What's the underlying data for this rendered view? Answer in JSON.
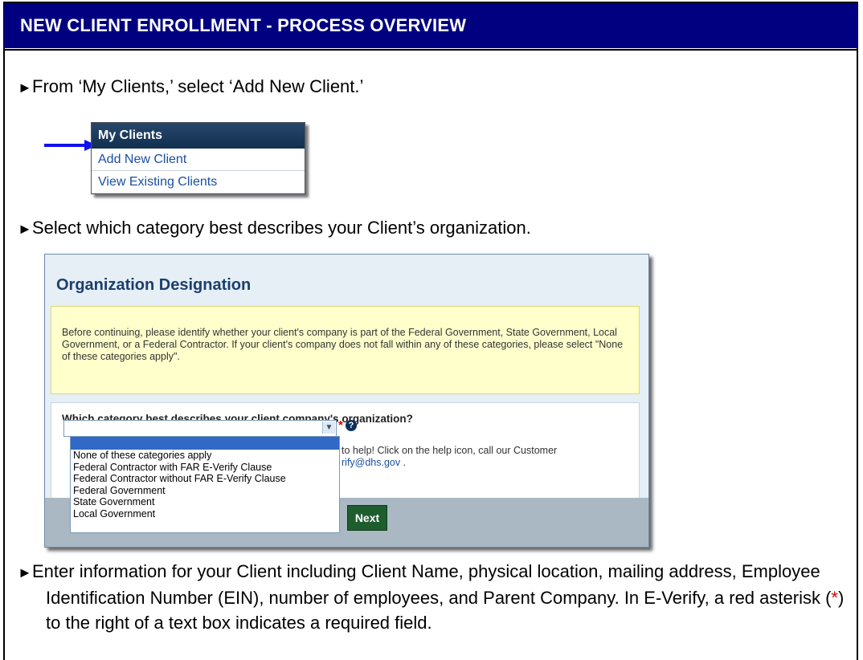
{
  "header": {
    "title": "NEW CLIENT ENROLLMENT - PROCESS OVERVIEW"
  },
  "steps": [
    "From ‘My Clients,’ select ‘Add New Client.’",
    "Select which category best describes your Client’s organization.",
    "Enter information for your Client including Client Name, physical location, mailing address, Employee Identification Number (EIN), number of employees, and Parent Company. In E-Verify, a red asterisk (",
    "*",
    ") to the right of a text box indicates a required field."
  ],
  "my_clients": {
    "heading": "My Clients",
    "items": [
      "Add New Client",
      "View Existing Clients"
    ]
  },
  "org_designation": {
    "title": "Organization Designation",
    "note": "Before continuing, please identify whether your client's company is part of the Federal Government, State Government, Local Government, or a Federal Contractor. If your client's company does not fall within any of these categories, please select \"None of these categories apply\".",
    "question": "Which category best describes your client company's organization?",
    "selected_value": "",
    "options": [
      "None of these categories apply",
      "Federal Contractor with FAR E-Verify Clause",
      "Federal Contractor without FAR E-Verify Clause",
      "Federal Government",
      "State Government",
      "Local Government"
    ],
    "help_line1": "to help! Click on the help icon, call our Customer",
    "help_line2_link": "rify@dhs.gov",
    "help_line2_end": " .",
    "next_label": "Next"
  },
  "colors": {
    "header_bg": "#000080",
    "required_asterisk": "#e00000",
    "next_button": "#1e5d2e",
    "arrow": "#1010ee"
  }
}
